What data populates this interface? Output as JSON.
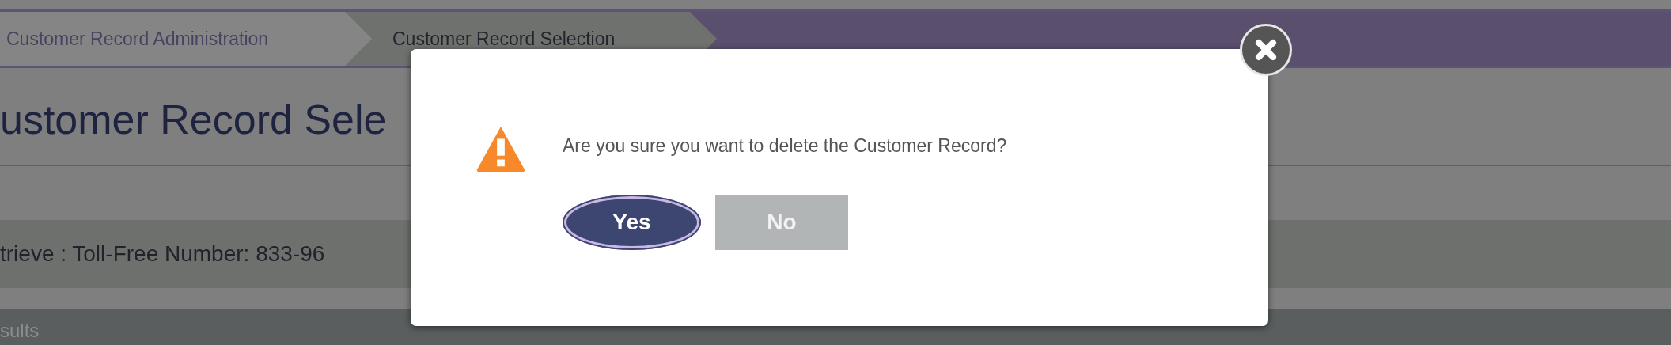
{
  "breadcrumbs": [
    {
      "label": "Customer Record Administration",
      "selected": false
    },
    {
      "label": "Customer Record Selection",
      "selected": true
    }
  ],
  "page_title": "ustomer Record Sele",
  "retrieve_bar": {
    "text": "trieve : Toll-Free Number: 833-96"
  },
  "results_header": {
    "text": "sults"
  },
  "dialog": {
    "message": "Are you sure you want to delete the Customer Record?",
    "buttons": [
      {
        "label": "Yes",
        "kind": "primary",
        "focused": true
      },
      {
        "label": "No",
        "kind": "secondary",
        "focused": false
      }
    ]
  }
}
